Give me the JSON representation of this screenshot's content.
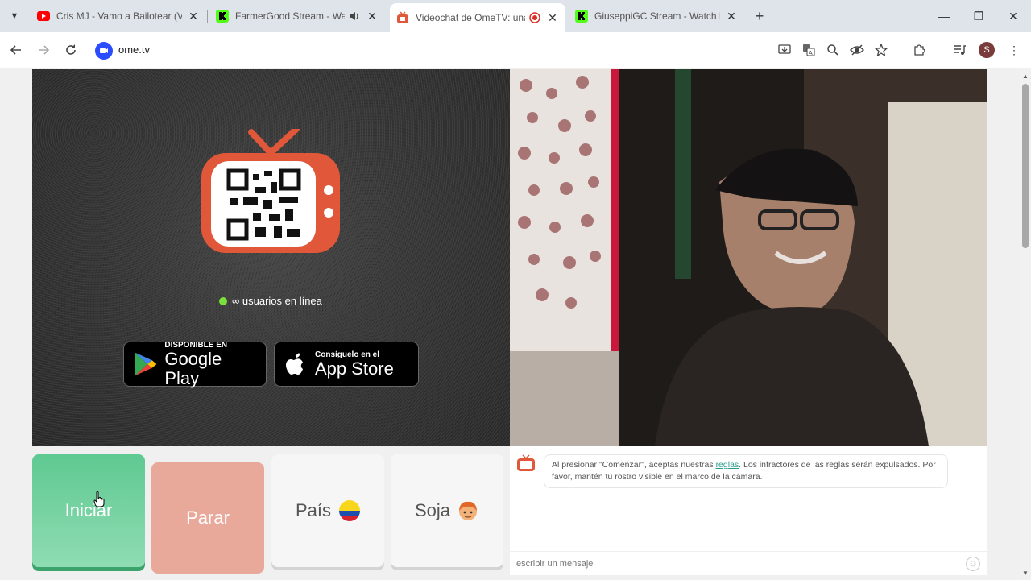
{
  "browser": {
    "tabs": [
      {
        "title": "Cris MJ - Vamo a Bailotear (Visu",
        "icon": "youtube-icon",
        "active": false
      },
      {
        "title": "FarmerGood Stream - Watch",
        "icon": "kick-icon",
        "active": false
      },
      {
        "title": "Videochat de OmeTV: una a",
        "icon": "ometv-icon",
        "active": true
      },
      {
        "title": "GiuseppiGC Stream - Watch Liv",
        "icon": "kick-icon",
        "active": false
      }
    ],
    "url": "ome.tv",
    "profile_initial": "S"
  },
  "page": {
    "online_text": "∞ usuarios en línea",
    "google_play": {
      "small": "DISPONIBLE EN",
      "big": "Google Play"
    },
    "app_store": {
      "small": "Consíguelo en el",
      "big": "App Store"
    },
    "buttons": {
      "start": "Iniciar",
      "stop": "Parar",
      "country": "País",
      "gender": "Soja"
    },
    "chat": {
      "notice_before_link": "Al presionar \"Comenzar\", aceptas nuestras ",
      "notice_link": "reglas",
      "notice_after_link": ". Los infractores de las reglas serán expulsados. Por favor, mantén tu rostro visible en el marco de la cámara.",
      "message_placeholder": "escribir un mensaje"
    }
  },
  "colors": {
    "start": "#5fc992",
    "stop": "#e9a99a",
    "tv": "#e0573a",
    "online_dot": "#7ae03a"
  }
}
